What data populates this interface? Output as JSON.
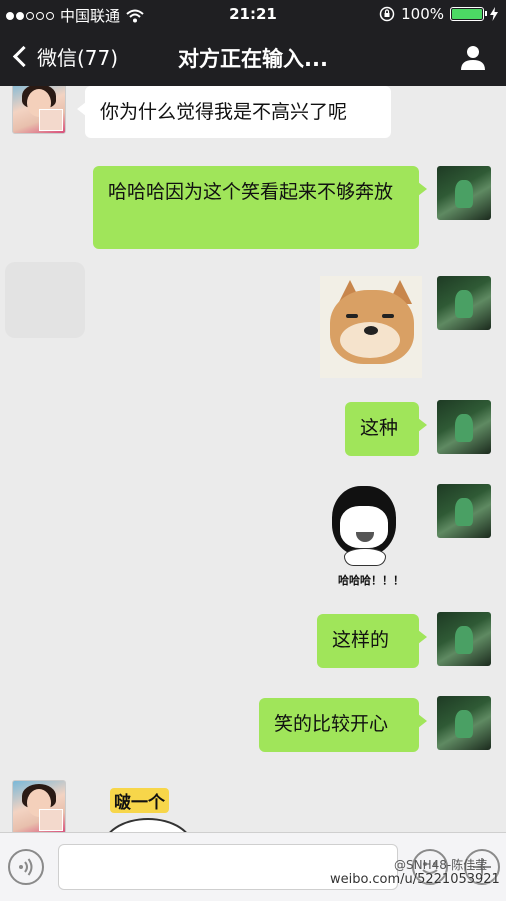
{
  "status_bar": {
    "carrier": "中国联通",
    "time": "21:21",
    "battery": "100%",
    "battery_level": 1.0,
    "signal_dots_filled": 2,
    "signal_dots_total": 5,
    "icons": [
      "signal-dots-icon",
      "wifi-icon",
      "orientation-lock-icon",
      "battery-icon",
      "charging-icon"
    ]
  },
  "nav": {
    "back_label": "微信(77)",
    "title": "对方正在输入...",
    "icons": [
      "chevron-left-icon",
      "user-profile-icon"
    ]
  },
  "messages": [
    {
      "from": "friend",
      "type": "text",
      "text": "你为什么觉得我是不高兴了呢"
    },
    {
      "from": "me",
      "type": "text",
      "text": "哈哈哈因为这个笑看起来不够奔放"
    },
    {
      "from": "me",
      "type": "sticker",
      "sticker": "shiba-doge-smile"
    },
    {
      "from": "me",
      "type": "text",
      "text": "这种"
    },
    {
      "from": "me",
      "type": "sticker",
      "sticker": "panda-meme-laugh",
      "caption": "哈哈哈！！！"
    },
    {
      "from": "me",
      "type": "text",
      "text": "这样的"
    },
    {
      "from": "me",
      "type": "text",
      "text": "笑的比较开心"
    },
    {
      "from": "friend",
      "type": "sticker",
      "sticker": "kiss-cartoon",
      "caption": "啵一个"
    }
  ],
  "input_bar": {
    "placeholder": "",
    "icons": [
      "voice-icon",
      "emoji-icon",
      "plus-icon"
    ]
  },
  "watermark": {
    "line1": "@SNH48-陈佳莹",
    "line2": "weibo.com/u/5221053921"
  },
  "colors": {
    "bar_bg": "#1f1f22",
    "chat_bg": "#ebebeb",
    "my_bubble": "#a0e55a",
    "friend_bubble": "#ffffff",
    "battery_green": "#4cd964"
  }
}
